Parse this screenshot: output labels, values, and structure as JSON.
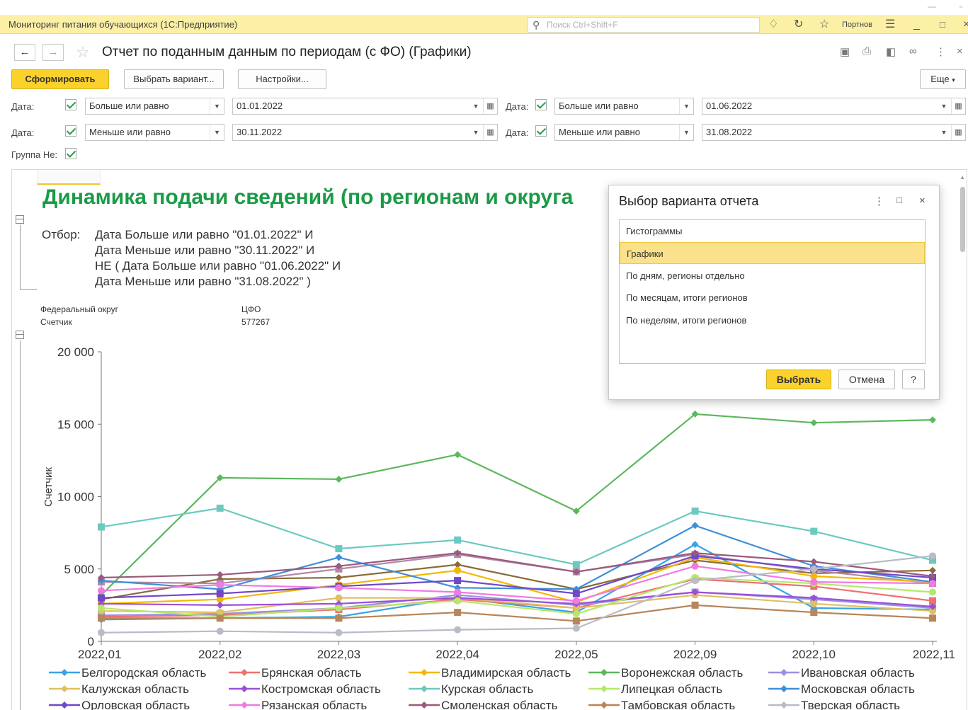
{
  "app": {
    "title": "Мониторинг питания обучающихся  (1С:Предприятие)",
    "search_placeholder": "Поиск Ctrl+Shift+F",
    "user": "Портнов"
  },
  "form": {
    "title": "Отчет по поданным данным по периодам (с ФО) (Графики)"
  },
  "toolbar": {
    "generate": "Сформировать",
    "choose_variant": "Выбрать вариант...",
    "settings": "Настройки...",
    "more": "Еще"
  },
  "filters": {
    "date_label": "Дата:",
    "date_label_right": "Дата:",
    "group_not_label": "Группа Не:",
    "row1": {
      "cond_left": "Больше или равно",
      "date_left": "01.01.2022",
      "cond_right": "Больше или равно",
      "date_right": "01.06.2022"
    },
    "row2": {
      "cond_left": "Меньше или равно",
      "date_left": "30.11.2022",
      "cond_right": "Меньше или равно",
      "date_right": "31.08.2022"
    }
  },
  "report": {
    "title": "Динамика подачи сведений (по регионам и округа",
    "otbor_label": "Отбор:",
    "otbor_lines": [
      "Дата Больше или равно \"01.01.2022\" И",
      "Дата Меньше или равно \"30.11.2022\" И",
      "НЕ ( Дата Больше или равно \"01.06.2022\" И",
      "Дата Меньше или равно \"31.08.2022\" )"
    ],
    "fo_label": "Федеральный округ",
    "fo_value": "ЦФО",
    "counter_label": "Счетчик",
    "counter_value": "577267"
  },
  "chart_data": {
    "type": "line",
    "title": "",
    "xlabel": "",
    "ylabel": "Счетчик",
    "ylim": [
      0,
      20000
    ],
    "yticks": [
      0,
      5000,
      10000,
      15000,
      20000
    ],
    "ytick_labels": [
      "0",
      "5 000",
      "10 000",
      "15 000",
      "20 000"
    ],
    "categories": [
      "2022,01",
      "2022,02",
      "2022,03",
      "2022,04",
      "2022,05",
      "2022,09",
      "2022,10",
      "2022,11"
    ],
    "legend_position": "bottom",
    "series": [
      {
        "name": "Белгородская область",
        "color": "#3aa3e3",
        "values": [
          1500,
          1600,
          1700,
          3000,
          2000,
          6700,
          2300,
          2200
        ]
      },
      {
        "name": "Брянская область",
        "color": "#f07070",
        "values": [
          1700,
          1800,
          2200,
          2900,
          2300,
          4300,
          3800,
          2800
        ]
      },
      {
        "name": "Владимирская область",
        "color": "#f5b800",
        "values": [
          2600,
          2900,
          3900,
          4900,
          2700,
          5800,
          4500,
          4100
        ]
      },
      {
        "name": "Воронежская область",
        "color": "#5cb85c",
        "values": [
          3200,
          11300,
          11200,
          12900,
          9000,
          15700,
          15100,
          15300
        ]
      },
      {
        "name": "Ивановская область",
        "color": "#9b8fe3",
        "values": [
          1800,
          1900,
          2300,
          3200,
          2500,
          3400,
          2900,
          2300
        ]
      },
      {
        "name": "Калужская область",
        "color": "#e0c060",
        "values": [
          2100,
          2000,
          3000,
          3000,
          2300,
          3200,
          2600,
          2100
        ]
      },
      {
        "name": "Костромская область",
        "color": "#9b4fd8",
        "values": [
          2600,
          2500,
          2600,
          3000,
          2600,
          3400,
          3000,
          2400
        ]
      },
      {
        "name": "Курская область",
        "color": "#6cc9c0",
        "values": [
          7900,
          9200,
          6400,
          7000,
          5300,
          9000,
          7600,
          5600
        ]
      },
      {
        "name": "Липецкая область",
        "color": "#b5e86a",
        "values": [
          2300,
          1700,
          2300,
          2800,
          1900,
          4400,
          4000,
          3400
        ]
      },
      {
        "name": "Московская область",
        "color": "#3f8fd8",
        "values": [
          4200,
          3600,
          5800,
          3700,
          3600,
          8000,
          5200,
          4100
        ]
      },
      {
        "name": "Орловская область",
        "color": "#7048c8",
        "values": [
          3000,
          3300,
          3800,
          4200,
          3300,
          5900,
          5000,
          4400
        ]
      },
      {
        "name": "Рязанская область",
        "color": "#f07ae0",
        "values": [
          3500,
          3900,
          3700,
          3400,
          2800,
          5200,
          4100,
          4000
        ]
      },
      {
        "name": "Смоленская область",
        "color": "#9a5a7e",
        "values": [
          4400,
          4600,
          5200,
          6100,
          4800,
          6100,
          5500,
          4500
        ]
      },
      {
        "name": "Тамбовская область",
        "color": "#b8865a",
        "values": [
          1600,
          1600,
          1600,
          2000,
          1400,
          2500,
          2000,
          1600
        ]
      },
      {
        "name": "Тверская область",
        "color": "#b8bcc6",
        "values": [
          600,
          700,
          600,
          800,
          900,
          4200,
          5000,
          5900
        ]
      },
      {
        "name": "",
        "color": "#8b6a3a",
        "values": [
          2900,
          4300,
          4400,
          5300,
          3600,
          5600,
          4700,
          4900
        ]
      },
      {
        "name": "",
        "color": "#b08aa8",
        "values": [
          4100,
          4000,
          5000,
          6000,
          4800,
          6000,
          4900,
          4000
        ]
      }
    ]
  },
  "dialog": {
    "title": "Выбор варианта отчета",
    "items": [
      "Гистограммы",
      "Графики",
      "По дням, регионы отдельно",
      "По месяцам, итоги регионов",
      "По неделям, итоги регионов"
    ],
    "selected_index": 1,
    "choose": "Выбрать",
    "cancel": "Отмена",
    "help": "?"
  }
}
